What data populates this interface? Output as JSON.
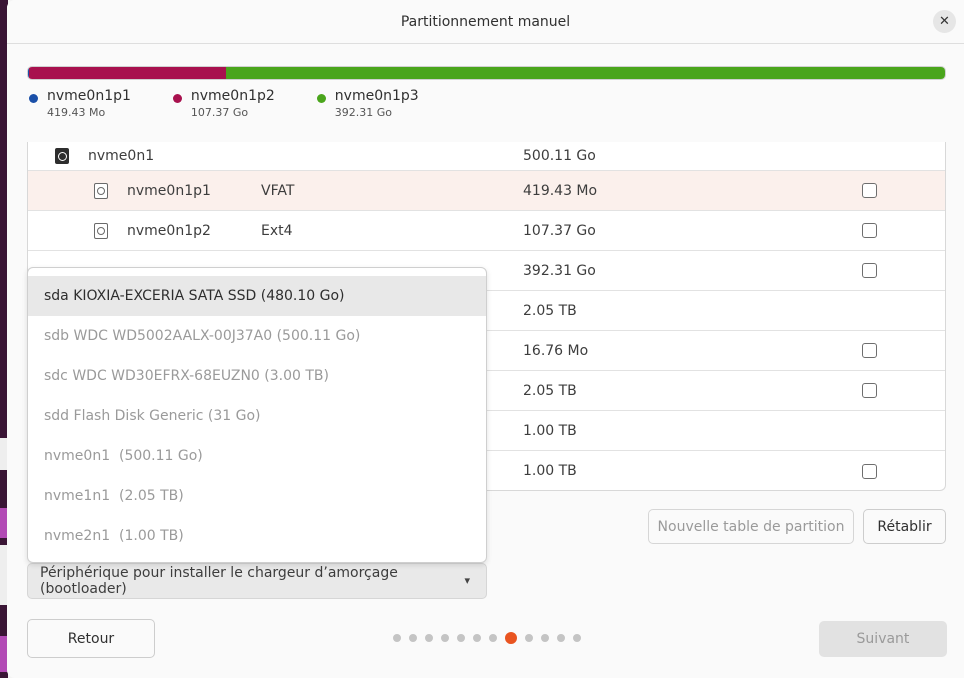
{
  "dialog": {
    "title": "Partitionnement manuel",
    "close_icon": "close-icon"
  },
  "usage_bar": {
    "segments": [
      {
        "name": "nvme0n1p1",
        "color": "#1a4fa8",
        "fraction": 0.0008
      },
      {
        "name": "nvme0n1p2",
        "color": "#a8114e",
        "fraction": 0.2148
      },
      {
        "name": "nvme0n1p3",
        "color": "#4aa51c",
        "fraction": 0.7844
      }
    ]
  },
  "legend": [
    {
      "name": "nvme0n1p1",
      "size": "419.43 Mo",
      "color": "#1a4fa8"
    },
    {
      "name": "nvme0n1p2",
      "size": "107.37 Go",
      "color": "#a8114e"
    },
    {
      "name": "nvme0n1p3",
      "size": "392.31 Go",
      "color": "#4aa51c"
    }
  ],
  "table": {
    "rows": [
      {
        "name": "nvme0n1",
        "fs": "",
        "size": "500.11 Go"
      },
      {
        "name": "nvme0n1p1",
        "fs": "VFAT",
        "size": "419.43 Mo"
      },
      {
        "name": "nvme0n1p2",
        "fs": "Ext4",
        "size": "107.37 Go"
      },
      {
        "name": "",
        "fs": "",
        "size": "392.31 Go"
      },
      {
        "name": "",
        "fs": "",
        "size": "2.05 TB"
      },
      {
        "name": "",
        "fs": "",
        "size": "16.76 Mo"
      },
      {
        "name": "",
        "fs": "",
        "size": "2.05 TB"
      },
      {
        "name": "",
        "fs": "",
        "size": "1.00 TB"
      },
      {
        "name": "",
        "fs": "",
        "size": "1.00 TB"
      }
    ]
  },
  "buttons": {
    "new_table": "Nouvelle table de partition",
    "reset": "Rétablir",
    "back": "Retour",
    "next": "Suivant"
  },
  "bootloader": {
    "label": "Périphérique pour installer le chargeur d’amorçage (bootloader)",
    "options": [
      "sda KIOXIA-EXCERIA SATA SSD (480.10 Go)",
      "sdb WDC WD5002AALX-00J37A0 (500.11 Go)",
      "sdc WDC WD30EFRX-68EUZN0 (3.00 TB)",
      "sdd Flash Disk Generic (31 Go)",
      "nvme0n1  (500.11 Go)",
      "nvme1n1  (2.05 TB)",
      "nvme2n1  (1.00 TB)"
    ],
    "highlighted_index": 0
  },
  "pager": {
    "total": 12,
    "current": 8
  }
}
